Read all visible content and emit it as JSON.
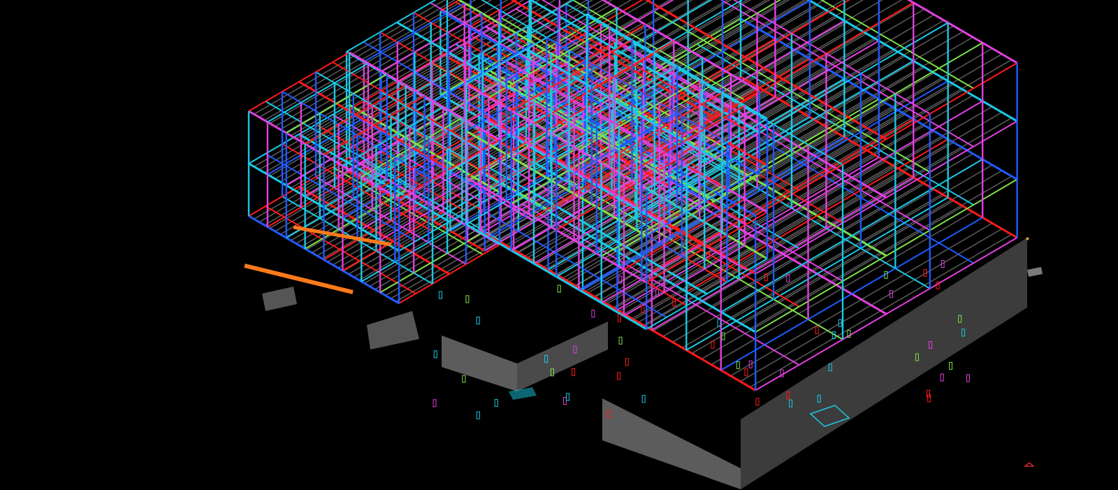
{
  "viewport": {
    "background": "#000000",
    "view": "3d-isometric",
    "content": "structural-steel-frame-model"
  },
  "colors": {
    "slab": "#4a4a4a",
    "slab_side": "#5c5c5c",
    "deck": "#8a8a8a",
    "red": "#ff1a1a",
    "blue": "#1e5bff",
    "cyan": "#19c9e6",
    "magenta": "#e040e0",
    "green": "#7ee04a",
    "orange": "#ff7a1a",
    "violet": "#9b5cff"
  },
  "icons": [
    "ucs-origin-icon",
    "navigation-marker-icon"
  ]
}
